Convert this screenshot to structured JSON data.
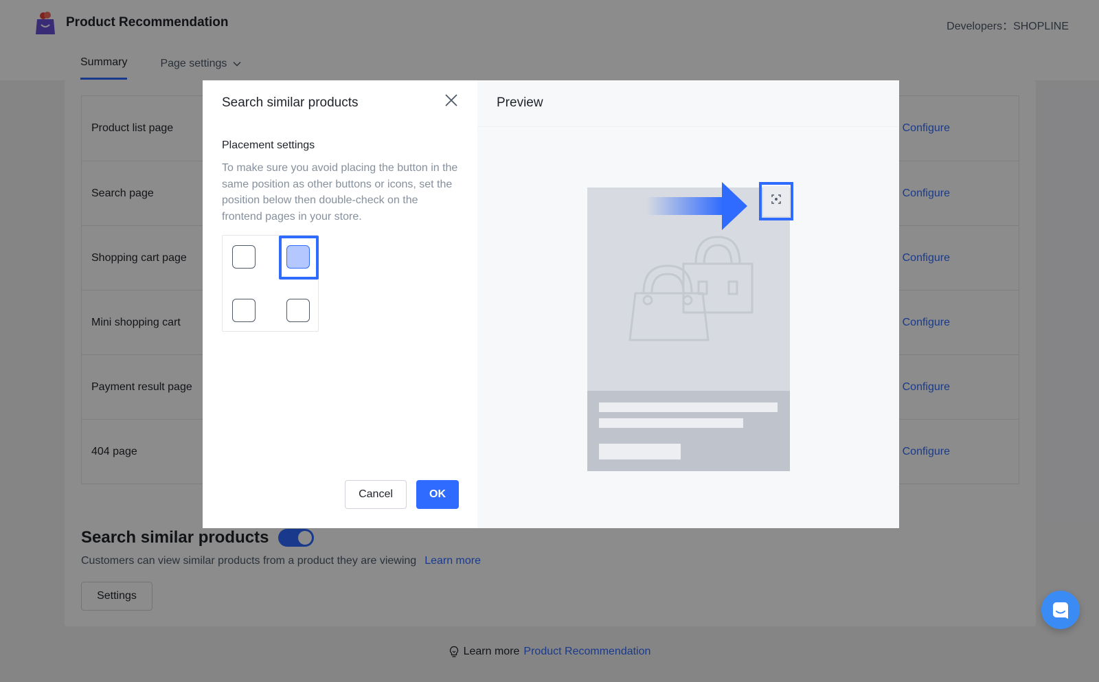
{
  "app": {
    "title": "Product Recommendation",
    "developer": "Developers：SHOPLINE"
  },
  "tabs": [
    {
      "label": "Summary",
      "active": true
    },
    {
      "label": "Page settings",
      "active": false
    }
  ],
  "pages_table": [
    {
      "name": "Product list page",
      "action": "Configure"
    },
    {
      "name": "Search page",
      "action": "Configure"
    },
    {
      "name": "Shopping cart page",
      "action": "Configure"
    },
    {
      "name": "Mini shopping cart",
      "action": "Configure"
    },
    {
      "name": "Payment result page",
      "action": "Configure"
    },
    {
      "name": "404 page",
      "action": "Configure"
    }
  ],
  "feature": {
    "title": "Search similar products",
    "enabled": true,
    "description": "Customers can view similar products from a product they are viewing",
    "learn_more": "Learn more",
    "settings_label": "Settings"
  },
  "footer": {
    "prefix": "Learn more",
    "link": "Product Recommendation"
  },
  "modal": {
    "title": "Search similar products",
    "placement_title": "Placement settings",
    "placement_desc": "To make sure you avoid placing the button in the same position as other buttons or icons, set the position below then double-check on the frontend pages in your store.",
    "selected_position": "top-right",
    "cancel_label": "Cancel",
    "ok_label": "OK",
    "preview_title": "Preview"
  },
  "colors": {
    "accent": "#2f6bff",
    "chat": "#3b8bf5"
  },
  "icons": [
    "app-logo-icon",
    "chevron-down-icon",
    "close-icon",
    "scan-icon",
    "bulb-icon",
    "chat-icon",
    "handbag-icon"
  ]
}
